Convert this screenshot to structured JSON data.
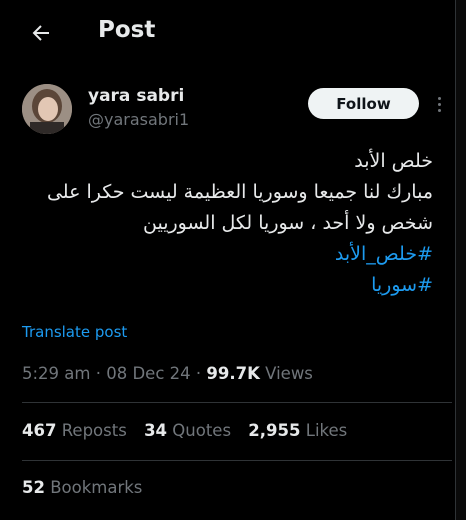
{
  "header": {
    "back_icon": "arrow-left-icon",
    "title": "Post"
  },
  "author": {
    "display_name": "yara sabri",
    "handle": "@yarasabri1",
    "follow_label": "Follow",
    "more_icon": "more-vertical-icon"
  },
  "post": {
    "lines": [
      "خلص الأبد",
      "مبارك لنا جميعا وسوريا العظيمة ليست حكرا على",
      "شخص ولا أحد ، سوريا لكل السوريين"
    ],
    "hashtags": [
      "#خلص_الأبد",
      "#سوريا"
    ],
    "translate_label": "Translate post"
  },
  "meta": {
    "time": "5:29 am",
    "date": "08 Dec 24",
    "views_count": "99.7K",
    "views_label": "Views",
    "separator": "·"
  },
  "stats": {
    "reposts_count": "467",
    "reposts_label": "Reposts",
    "quotes_count": "34",
    "quotes_label": "Quotes",
    "likes_count": "2,955",
    "likes_label": "Likes",
    "bookmarks_count": "52",
    "bookmarks_label": "Bookmarks"
  },
  "colors": {
    "background": "#000000",
    "text": "#e7e9ea",
    "muted": "#71767b",
    "accent": "#1d9bf0",
    "border": "#2f3336"
  }
}
